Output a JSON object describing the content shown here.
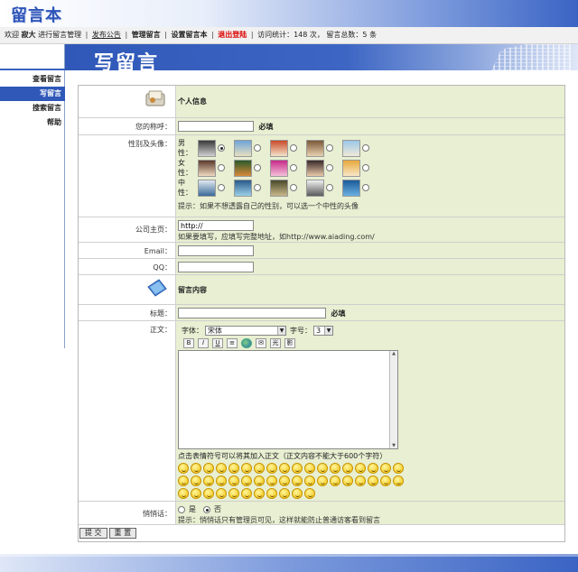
{
  "header": {
    "logo": "留言本"
  },
  "infobar": {
    "welcome": "欢迎",
    "user": "寂大",
    "welcome_tail": "进行留言管理",
    "links": [
      "发布公告",
      "管理留言",
      "设置留言本",
      "退出登陆"
    ],
    "stats": "访问统计：148 次， 留言总数：5 条"
  },
  "sidebar": {
    "items": [
      "查看留言",
      "写留言",
      "搜索留言",
      "帮助"
    ],
    "active_index": 1
  },
  "banner": {
    "title": "写留言"
  },
  "form": {
    "section_personal": "个人信息",
    "nickname_label": "您的称呼：",
    "nickname_value": "",
    "required": "必填",
    "gender_label": "性别及头像：",
    "male_label": "男性：",
    "female_label": "女性：",
    "neutral_label": "中性：",
    "avatar_hint": "提示：如果不想透露自己的性别，可以选一个中性的头像",
    "homepage_label": "公司主页：",
    "homepage_value": "http://",
    "homepage_hint": "如果要填写，应填写完整地址，如http://www.aiading.com/",
    "email_label": "Email：",
    "qq_label": "QQ：",
    "section_message": "留言内容",
    "subject_label": "标题：",
    "body_label": "正文：",
    "font_label": "字体：",
    "font_value": "宋体",
    "size_label": "字号：",
    "size_value": "3",
    "toolbar_buttons": [
      "B",
      "I",
      "U",
      "≡",
      "",
      "✉",
      "光",
      "影"
    ],
    "emoji_hint": "点击表情符号可以将其加入正文（正文内容不能大于600个字符）",
    "private_label": "悄悄话：",
    "yes": "是",
    "no": "否",
    "private_hint": "提示：悄悄话只有管理员可见，这样就能防止普通访客看到留言",
    "submit": "提 交",
    "reset": "重 置"
  },
  "colors": {
    "accent": "#2f58b8",
    "form_bg": "#e8efd2",
    "logout": "#dd0000"
  }
}
